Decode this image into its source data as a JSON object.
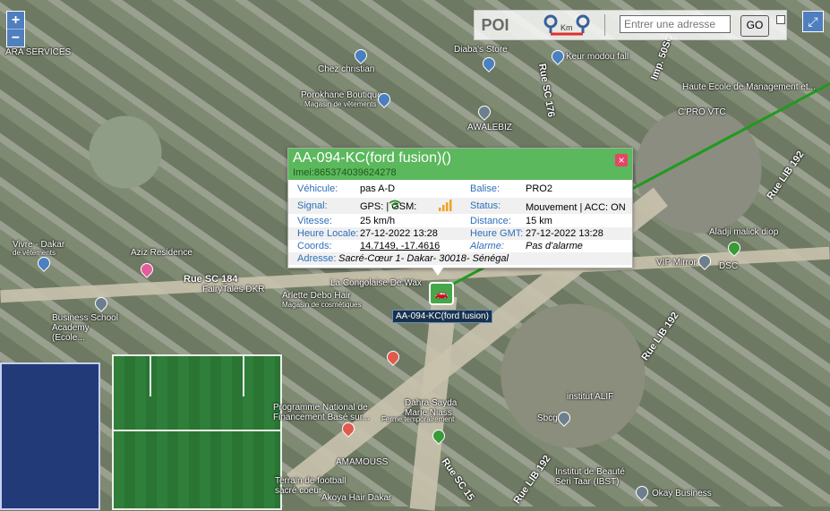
{
  "map": {
    "labels": [
      "Chez christian",
      "Porokhane Boutique",
      "Magasin de vêtements",
      "AWALEBIZ",
      "Diaba's Store",
      "Keur modou fall",
      "C'PRO VTC",
      "Haute Ecole de Management et...",
      "Aziz Residence",
      "FairyTales DKR",
      "Arlette Debo Hair",
      "Magasin de cosmétiques",
      "La Congolaise De Wax",
      "Business School Academy (Ecole...",
      "Programme National de Financement Basé sur...",
      "Dahra Sayda Marie Niass",
      "Ferme temporairement",
      "AMAMOUSS",
      "Terrain de football sacré coeur",
      "Akoya Hair Dakar",
      "institut ALIF",
      "Sbcg",
      "Institut de Beauté Seri Taar (IBST)",
      "Okay Business",
      "Aladji malick diop",
      "VIP Mirror",
      "DSC",
      "ARA SERVICES",
      "Vivre - Dakar",
      "de vêtements"
    ],
    "roads": [
      "Rue SC 184",
      "Rue SC 176",
      "Rue LIB 192",
      "Rue LIB 192",
      "Rue LIB 192",
      "Rue SC 15",
      "Imp. 50SC"
    ]
  },
  "zoom": {
    "in": "+",
    "out": "−"
  },
  "toolbar": {
    "poi": "POI",
    "km": "Km",
    "address_placeholder": "Entrer une adresse",
    "go": "GO"
  },
  "expand_icon": "⤢",
  "popup": {
    "title": "AA-094-KC(ford fusion)()",
    "imei": "Imei:865374039624278",
    "close": "×",
    "rows": [
      {
        "l1": "Véhicule:",
        "v1": "pas A-D",
        "l2": "Balise:",
        "v2": "PRO2"
      },
      {
        "l1": "Signal:",
        "v1": "GPS:  | GSM:",
        "l2": "Status:",
        "v2": "Mouvement | ACC: ON"
      },
      {
        "l1": "Vitesse:",
        "v1": "25 km/h",
        "l2": "Distance:",
        "v2": "15 km"
      },
      {
        "l1": "Heure Locale:",
        "v1": "27-12-2022 13:28",
        "l2": "Heure GMT:",
        "v2": "27-12-2022 13:28"
      },
      {
        "l1": "Coords:",
        "v1": "14.7149, -17.4616",
        "l2": "Alarme:",
        "v2": "Pas d'alarme"
      },
      {
        "l1": "Adresse:",
        "v1": "Sacré-Cœur 1- Dakar- 30018- Sénégal"
      }
    ]
  },
  "vehicle": {
    "label": "AA-094-KC(ford fusion)",
    "icon": "car-icon"
  },
  "colors": {
    "popup_header": "#5cb85c",
    "route": "#1f9a1f",
    "label_blue": "#2e6fb8"
  }
}
